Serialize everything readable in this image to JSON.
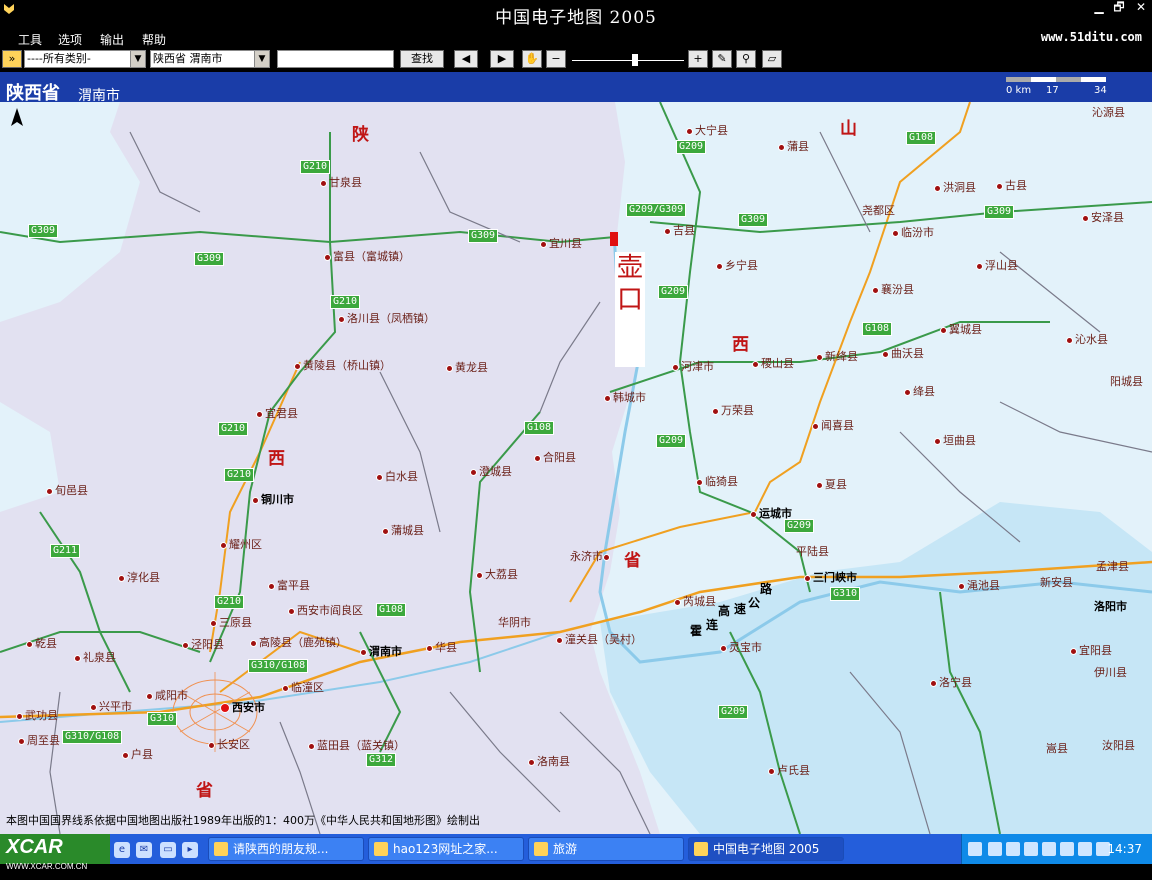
{
  "window": {
    "title": "中国电子地图 2005",
    "buttons": {
      "minimize": "▁",
      "restore": "🗗",
      "close": "✕"
    }
  },
  "menu": {
    "items": [
      "工具",
      "选项",
      "输出",
      "帮助"
    ],
    "site": "www.51ditu.com"
  },
  "toolbar": {
    "chevron": "»",
    "category_value": "----所有类别-",
    "region_value": "陕西省 渭南市",
    "search_value": "",
    "search_button": "查找",
    "icons": [
      "back-icon",
      "forward-icon",
      "hand-icon",
      "zoom-out-icon",
      "zoom-in-icon",
      "measure-icon",
      "locate-icon",
      "layers-icon"
    ]
  },
  "header": {
    "province": "陕西省",
    "city": "渭南市",
    "scale": {
      "labels": [
        "0 km",
        "17",
        "34"
      ]
    }
  },
  "map": {
    "province_labels": [
      "陕",
      "西",
      "省",
      "山",
      "西",
      "省"
    ],
    "hukou": "壶口",
    "expressway": [
      "霍",
      "连",
      "高",
      "速",
      "公",
      "路"
    ],
    "credit": "本图中国国界线系依据中国地图出版社1989年出版的1：400万《中华人民共和国地形图》绘制出"
  },
  "places": [
    {
      "name": "甘泉县"
    },
    {
      "name": "富县（富城镇）"
    },
    {
      "name": "洛川县（凤栖镇）"
    },
    {
      "name": "黄陵县（桥山镇）"
    },
    {
      "name": "黄龙县"
    },
    {
      "name": "宜君县"
    },
    {
      "name": "宜川县"
    },
    {
      "name": "大宁县"
    },
    {
      "name": "蒲县"
    },
    {
      "name": "吉县"
    },
    {
      "name": "乡宁县"
    },
    {
      "name": "河津市"
    },
    {
      "name": "稷山县"
    },
    {
      "name": "新绛县"
    },
    {
      "name": "曲沃县"
    },
    {
      "name": "万荣县"
    },
    {
      "name": "闻喜县"
    },
    {
      "name": "绛县"
    },
    {
      "name": "垣曲县"
    },
    {
      "name": "洪洞县"
    },
    {
      "name": "古县"
    },
    {
      "name": "尧都区"
    },
    {
      "name": "临汾市"
    },
    {
      "name": "浮山县"
    },
    {
      "name": "襄汾县"
    },
    {
      "name": "翼城县"
    },
    {
      "name": "沁水县"
    },
    {
      "name": "阳城县"
    },
    {
      "name": "沁源县"
    },
    {
      "name": "安泽县"
    },
    {
      "name": "韩城市"
    },
    {
      "name": "合阳县"
    },
    {
      "name": "澄城县"
    },
    {
      "name": "白水县"
    },
    {
      "name": "铜川市"
    },
    {
      "name": "耀州区"
    },
    {
      "name": "旬邑县"
    },
    {
      "name": "淳化县"
    },
    {
      "name": "蒲城县"
    },
    {
      "name": "富平县"
    },
    {
      "name": "大荔县"
    },
    {
      "name": "临猗县"
    },
    {
      "name": "运城市"
    },
    {
      "name": "夏县"
    },
    {
      "name": "平陆县"
    },
    {
      "name": "三门峡市"
    },
    {
      "name": "永济市"
    },
    {
      "name": "芮城县"
    },
    {
      "name": "灵宝市"
    },
    {
      "name": "潼关县（吴村）"
    },
    {
      "name": "华阴市"
    },
    {
      "name": "华县"
    },
    {
      "name": "渭南市"
    },
    {
      "name": "西安市阎良区"
    },
    {
      "name": "三原县"
    },
    {
      "name": "泾阳县"
    },
    {
      "name": "高陵县（鹿苑镇）"
    },
    {
      "name": "临潼区"
    },
    {
      "name": "咸阳市"
    },
    {
      "name": "西安市"
    },
    {
      "name": "长安区"
    },
    {
      "name": "蓝田县（蓝关镇）"
    },
    {
      "name": "乾县"
    },
    {
      "name": "礼泉县"
    },
    {
      "name": "兴平市"
    },
    {
      "name": "武功县"
    },
    {
      "name": "周至县"
    },
    {
      "name": "户县"
    },
    {
      "name": "洛南县"
    },
    {
      "name": "卢氏县"
    },
    {
      "name": "洛宁县"
    },
    {
      "name": "渑池县"
    },
    {
      "name": "新安县"
    },
    {
      "name": "孟津县"
    },
    {
      "name": "洛阳市"
    },
    {
      "name": "宜阳县"
    },
    {
      "name": "伊川县"
    },
    {
      "name": "嵩县"
    },
    {
      "name": "汝阳县"
    },
    {
      "name": "济源市"
    }
  ],
  "shields": [
    "G210",
    "G309",
    "G309",
    "G309",
    "G210",
    "G210",
    "G210",
    "G211",
    "G210",
    "G310/G108",
    "G310",
    "G310/G108",
    "G312",
    "G108",
    "G108",
    "G209",
    "G209/G309",
    "G309",
    "G209",
    "G209",
    "G209",
    "G310",
    "G108",
    "G108",
    "G309",
    "G209"
  ],
  "taskbar": {
    "start_label": "XCAR",
    "start_sub": "WWW.XCAR.COM.CN",
    "tasks": [
      "请陕西的朋友规...",
      "hao123网址之家...",
      "旅游",
      "中国电子地图 2005"
    ],
    "clock": "14:37"
  },
  "colors": {
    "shaanxi": "#e2e1f1",
    "shanxi": "#e3f2fa",
    "water": "#c6e6f6",
    "header": "#1a3da8",
    "road": "#3a9a4a",
    "highway": "#f0a020",
    "shield": "#3ca83c"
  }
}
